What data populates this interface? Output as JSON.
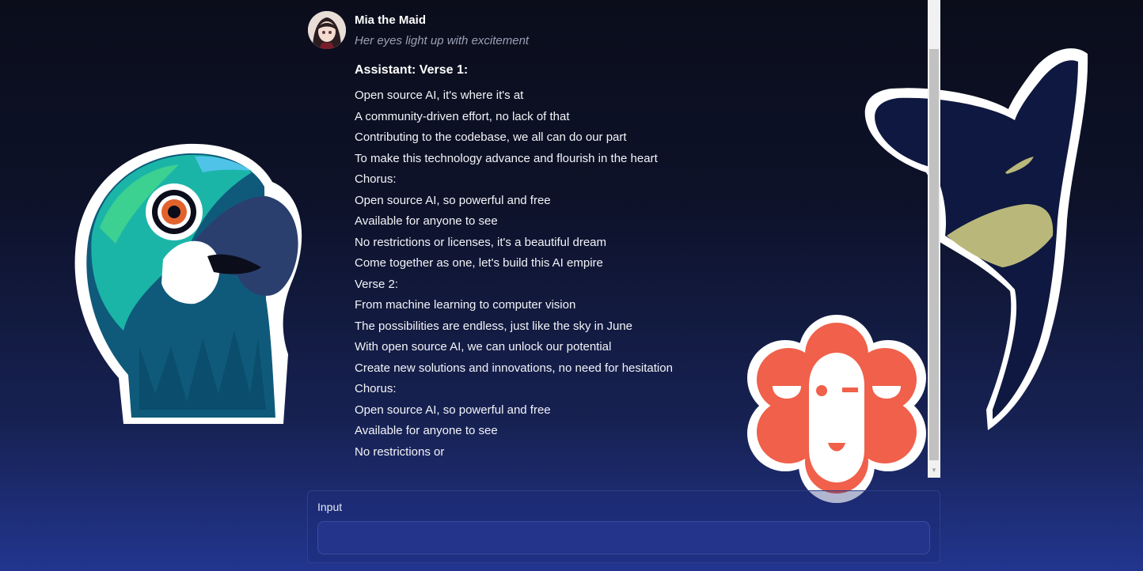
{
  "character": {
    "name": "Mia the Maid",
    "action": "Her eyes light up with excitement"
  },
  "message": {
    "heading": "Assistant: Verse 1:",
    "lines": [
      "Open source AI, it's where it's at",
      "A community-driven effort, no lack of that",
      "Contributing to the codebase, we all can do our part",
      "To make this technology advance and flourish in the heart",
      "Chorus:",
      "Open source AI, so powerful and free",
      "Available for anyone to see",
      "No restrictions or licenses, it's a beautiful dream",
      "Come together as one, let's build this AI empire",
      "Verse 2:",
      "From machine learning to computer vision",
      "The possibilities are endless, just like the sky in June",
      "With open source AI, we can unlock our potential",
      "Create new solutions and innovations, no need for hesitation",
      "Chorus:",
      "Open source AI, so powerful and free",
      "Available for anyone to see",
      "No restrictions or"
    ]
  },
  "input": {
    "label": "Input",
    "value": ""
  },
  "icons": {
    "avatar": "character-avatar",
    "parrot": "parrot-sticker",
    "deer": "deer-sticker",
    "flower": "flower-face-sticker"
  },
  "colors": {
    "accent": "#23348a",
    "flower": "#f0604a",
    "parrot_teal": "#1bb5a8",
    "deer_navy": "#0e1840"
  }
}
